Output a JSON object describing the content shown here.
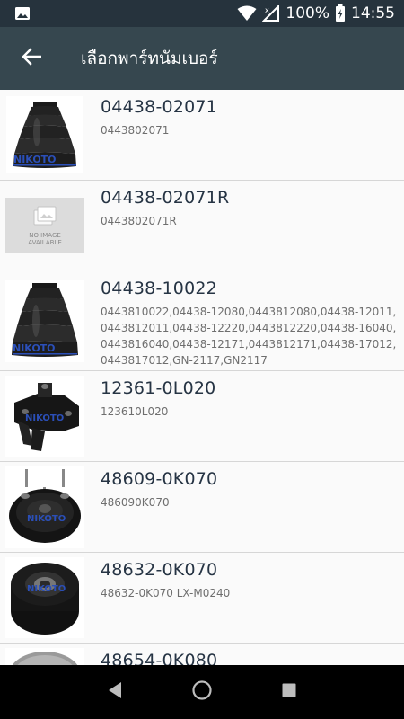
{
  "status_bar": {
    "battery_percent": "100%",
    "time": "14:55"
  },
  "app_bar": {
    "title": "เลือกพาร์ทนัมเบอร์"
  },
  "parts": [
    {
      "part_no": "04438-02071",
      "alt_no": "0443802071",
      "image": "boot"
    },
    {
      "part_no": "04438-02071R",
      "alt_no": "0443802071R",
      "image": "no-image"
    },
    {
      "part_no": "04438-10022",
      "alt_no": "0443810022,04438-12080,0443812080,04438-12011,0443812011,04438-12220,0443812220,04438-16040,0443816040,04438-12171,0443812171,04438-17012,0443817012,GN-2117,GN2117",
      "image": "boot"
    },
    {
      "part_no": "12361-0L020",
      "alt_no": "123610L020",
      "image": "mount"
    },
    {
      "part_no": "48609-0K070",
      "alt_no": "486090K070",
      "image": "strut"
    },
    {
      "part_no": "48632-0K070",
      "alt_no": "48632-0K070  LX-M0240",
      "image": "bushing"
    },
    {
      "part_no": "48654-0K080",
      "alt_no": "",
      "image": "disc"
    }
  ],
  "no_image_text": {
    "line1": "NO IMAGE",
    "line2": "AVAILABLE"
  },
  "brand_watermark": "NIKOTO",
  "icons": {
    "status_left": "image-icon",
    "wifi": "wifi-icon",
    "signal": "signal-off-icon",
    "battery": "battery-charging-icon",
    "back": "arrow-back-icon",
    "nav_back": "triangle-back-icon",
    "nav_home": "circle-home-icon",
    "nav_recent": "square-recent-icon"
  }
}
